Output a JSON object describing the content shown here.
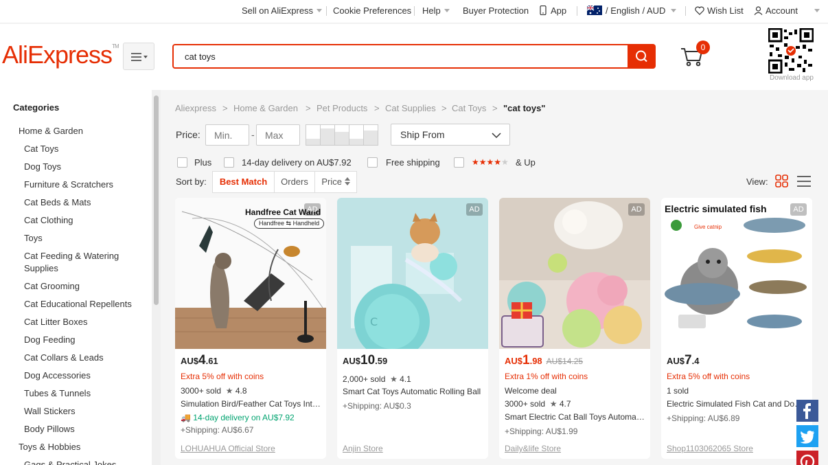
{
  "topbar": {
    "sell": "Sell on AliExpress",
    "cookie": "Cookie Preferences",
    "help": "Help",
    "buyer": "Buyer Protection",
    "app": "App",
    "lang": "/ English /",
    "currency": "AUD",
    "wishlist": "Wish List",
    "account": "Account"
  },
  "header": {
    "logo": "AliExpress",
    "search_value": "cat toys",
    "cart_count": "0",
    "download": "Download app"
  },
  "sidebar": {
    "title": "Categories",
    "items": [
      {
        "label": "Home & Garden",
        "level": 0
      },
      {
        "label": "Cat Toys",
        "level": 1
      },
      {
        "label": "Dog Toys",
        "level": 1
      },
      {
        "label": "Furniture & Scratchers",
        "level": 1
      },
      {
        "label": "Cat Beds & Mats",
        "level": 1
      },
      {
        "label": "Cat Clothing",
        "level": 1
      },
      {
        "label": "Toys",
        "level": 1
      },
      {
        "label": "Cat Feeding & Watering Supplies",
        "level": 1
      },
      {
        "label": "Cat Grooming",
        "level": 1
      },
      {
        "label": "Cat Educational Repellents",
        "level": 1
      },
      {
        "label": "Cat Litter Boxes",
        "level": 1
      },
      {
        "label": "Dog Feeding",
        "level": 1
      },
      {
        "label": "Cat Collars & Leads",
        "level": 1
      },
      {
        "label": "Dog Accessories",
        "level": 1
      },
      {
        "label": "Tubes & Tunnels",
        "level": 1
      },
      {
        "label": "Wall Stickers",
        "level": 1
      },
      {
        "label": "Body Pillows",
        "level": 1
      },
      {
        "label": "Toys & Hobbies",
        "level": 0
      },
      {
        "label": "Gags & Practical Jokes",
        "level": 1
      }
    ]
  },
  "breadcrumb": [
    "Aliexpress",
    "Home & Garden",
    "Pet Products",
    "Cat Supplies",
    "Cat Toys",
    "\"cat toys\""
  ],
  "filters": {
    "price_label": "Price:",
    "min_placeholder": "Min.",
    "max_placeholder": "Max",
    "dash": "-",
    "ship_from": "Ship From",
    "plus": "Plus",
    "delivery": "14-day delivery on AU$7.92",
    "free_shipping": "Free shipping",
    "rating_up": "& Up"
  },
  "sort": {
    "label": "Sort by:",
    "best_match": "Best Match",
    "orders": "Orders",
    "price": "Price",
    "view": "View:"
  },
  "products": [
    {
      "image_text": "Handfree Cat Wand",
      "image_subtext": "Handfree ⇆ Handheld",
      "ad": "AD",
      "currency": "AU$",
      "price_int": "4",
      "price_dec": ".61",
      "coins": "Extra 5% off with coins",
      "sold": "3000+ sold",
      "rating": "4.8",
      "title": "Simulation Bird/Feather Cat Toys Interactive",
      "delivery": "14-day delivery on AU$7.92",
      "shipping": "+Shipping: AU$6.67",
      "store": "LOHUAHUA Official Store"
    },
    {
      "ad": "AD",
      "currency": "AU$",
      "price_int": "10",
      "price_dec": ".59",
      "sold": "2,000+ sold",
      "rating": "4.1",
      "title": "Smart Cat Toys Automatic Rolling Ball",
      "shipping": "+Shipping: AU$0.3",
      "store": "Anjin Store"
    },
    {
      "ad": "AD",
      "currency": "AU$",
      "price_int": "1",
      "price_dec": ".98",
      "old_price": "AU$14.25",
      "coins": "Extra 1% off with coins",
      "deal": "Welcome deal",
      "sold": "3000+ sold",
      "rating": "4.7",
      "title": "Smart Electric Cat Ball Toys Automatic Rolling",
      "shipping": "+Shipping: AU$1.99",
      "store": "Daily&life Store"
    },
    {
      "image_text": "Electric simulated fish",
      "image_subtext": "Give catnip",
      "ad": "AD",
      "currency": "AU$",
      "price_int": "7",
      "price_dec": ".4",
      "coins": "Extra 5% off with coins",
      "sold": "1 sold",
      "title": "Electric Simulated Fish Cat and Dog Toy",
      "shipping": "+Shipping: AU$6.89",
      "store": "Shop1103062065 Store"
    }
  ],
  "colors": {
    "brand": "#e62e04",
    "delivery_green": "#00a36f",
    "facebook": "#3b5998",
    "twitter": "#1da1f2",
    "pinterest": "#cb2027"
  },
  "icons": [
    "menu-icon",
    "search-icon",
    "cart-icon",
    "phone-icon",
    "flag-au-icon",
    "heart-icon",
    "user-icon",
    "grid-view-icon",
    "list-view-icon",
    "facebook-icon",
    "twitter-icon",
    "pinterest-icon",
    "truck-icon"
  ]
}
